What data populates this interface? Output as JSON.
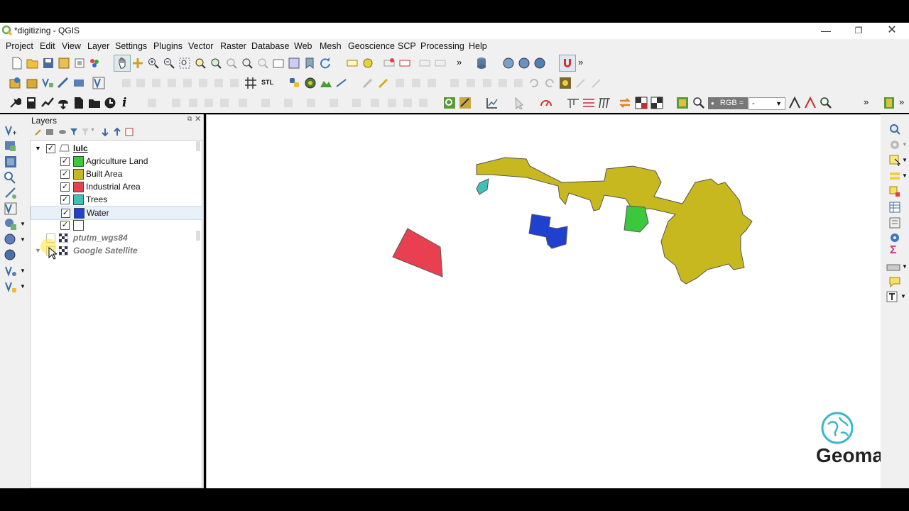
{
  "window": {
    "title": "*digitizing - QGIS"
  },
  "menu": [
    "Project",
    "Edit",
    "View",
    "Layer",
    "Settings",
    "Plugins",
    "Vector",
    "Raster",
    "Database",
    "Web",
    "Mesh",
    "Geoscience",
    "SCP",
    "Processing",
    "Help"
  ],
  "layers_panel": {
    "title": "Layers",
    "group": "lulc",
    "categories": [
      {
        "label": "Agriculture Land",
        "color": "#3cc83c"
      },
      {
        "label": "Built Area",
        "color": "#c8b820"
      },
      {
        "label": "Industrial Area",
        "color": "#e84050"
      },
      {
        "label": "Trees",
        "color": "#40c0b8"
      },
      {
        "label": "Water",
        "color": "#2040d0"
      },
      {
        "label": "",
        "color": "#ffffff"
      }
    ],
    "other_layers": [
      "ptutm_wgs84",
      "Google Satellite"
    ]
  },
  "scp_toolbar": {
    "rgb_label": "RGB =",
    "rgb_value": "-"
  },
  "watermark": {
    "text": "Geomap"
  }
}
